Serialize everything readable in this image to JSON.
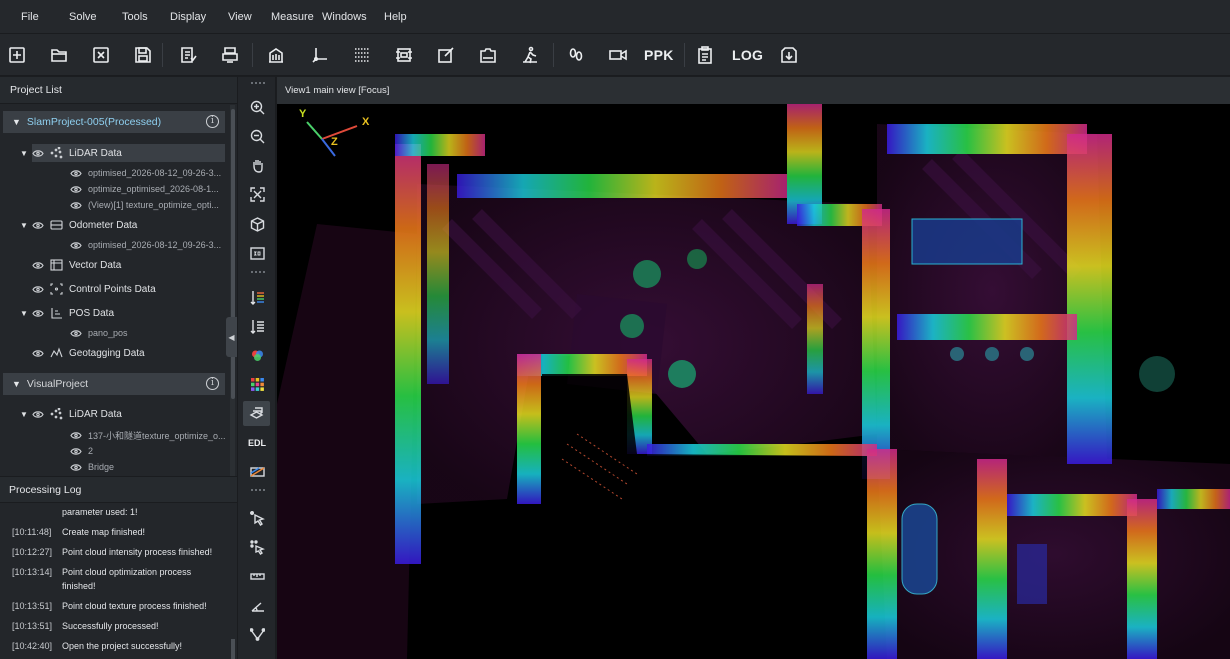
{
  "menubar": {
    "items": [
      "File",
      "Solve",
      "Tools",
      "Display",
      "View",
      "Measure",
      "Windows",
      "Help"
    ]
  },
  "toolbar": {
    "buttons": [
      {
        "icon": "new-project-icon"
      },
      {
        "icon": "open-folder-icon"
      },
      {
        "icon": "close-project-icon"
      },
      {
        "icon": "save-icon"
      },
      {
        "icon": "import-data-icon"
      },
      {
        "icon": "process-icon"
      },
      {
        "icon": "building-icon"
      },
      {
        "icon": "coordinate-icon"
      },
      {
        "icon": "grid-icon"
      },
      {
        "icon": "frame-icon"
      },
      {
        "icon": "edit-icon"
      },
      {
        "icon": "camera-box-icon"
      },
      {
        "icon": "walk-icon"
      },
      {
        "icon": "footprint-icon"
      },
      {
        "icon": "video-icon"
      }
    ],
    "ppk_label": "PPK",
    "log_label": "LOG"
  },
  "project_panel": {
    "title": "Project List",
    "projects": [
      {
        "name": "SlamProject-005(Processed)",
        "accent": "#8fd0f0",
        "groups": [
          {
            "label": "LiDAR Data",
            "icon": "point-cloud-icon",
            "children": [
              "optimised_2026-08-12_09-26-3...",
              "optimize_optimised_2026-08-1...",
              "(View)[1] texture_optimize_opti..."
            ]
          },
          {
            "label": "Odometer Data",
            "icon": "odometer-icon",
            "children": [
              "optimised_2026-08-12_09-26-3..."
            ]
          },
          {
            "label": "Vector Data",
            "icon": "vector-icon",
            "children": []
          },
          {
            "label": "Control Points Data",
            "icon": "control-points-icon",
            "children": []
          },
          {
            "label": "POS Data",
            "icon": "pos-icon",
            "children": [
              "pano_pos"
            ]
          },
          {
            "label": "Geotagging Data",
            "icon": "geotag-icon",
            "children": []
          }
        ]
      },
      {
        "name": "VisualProject",
        "accent": "#e2e4e7",
        "groups": [
          {
            "label": "LiDAR Data",
            "icon": "point-cloud-icon",
            "children": [
              "137-小和隧道texture_optimize_o...",
              "2",
              "Bridge"
            ]
          }
        ]
      }
    ]
  },
  "log_panel": {
    "title": "Processing Log",
    "entries": [
      {
        "time": "",
        "msg": "parameter used: 1!"
      },
      {
        "time": "[10:11:48]",
        "msg": "Create map finished!"
      },
      {
        "time": "[10:12:27]",
        "msg": "Point cloud intensity process finished!"
      },
      {
        "time": "[10:13:14]",
        "msg": "Point cloud optimization process finished!"
      },
      {
        "time": "[10:13:51]",
        "msg": "Point cloud texture process finished!"
      },
      {
        "time": "[10:13:51]",
        "msg": "Successfully processed!"
      },
      {
        "time": "[10:42:40]",
        "msg": "Open the project successfully!"
      }
    ]
  },
  "view_tools": {
    "edl_label": "EDL",
    "icons": [
      "zoom-in-icon",
      "zoom-out-icon",
      "pan-hand-icon",
      "fit-view-icon",
      "cube-view-icon",
      "3d-view-icon",
      "elevation-color-icon",
      "intensity-color-icon",
      "rgb-color-icon",
      "classification-color-icon",
      "layers-icon",
      "edl-icon",
      "gradient-icon",
      "select-icon",
      "multi-select-icon",
      "ruler-icon",
      "angle-icon",
      "polyline-icon"
    ]
  },
  "viewport": {
    "title": "View1 main view [Focus]",
    "axes": {
      "x": "X",
      "y": "Y",
      "z": "Z"
    },
    "colors": {
      "x": "#e8c020",
      "y": "#c8e020",
      "z": "#e8c020"
    }
  }
}
